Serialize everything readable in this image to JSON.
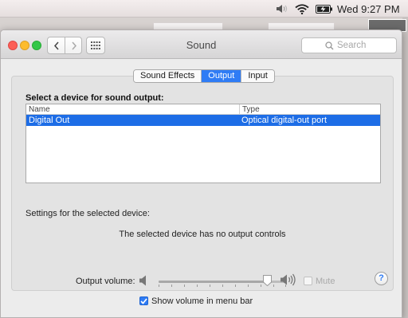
{
  "menubar": {
    "clock": "Wed 9:27 PM",
    "icons": [
      "volume-icon",
      "wifi-icon",
      "battery-charging-icon"
    ]
  },
  "window": {
    "title": "Sound",
    "search_placeholder": "Search"
  },
  "tabs": [
    {
      "label": "Sound Effects",
      "active": false
    },
    {
      "label": "Output",
      "active": true
    },
    {
      "label": "Input",
      "active": false
    }
  ],
  "output": {
    "select_label": "Select a device for sound output:",
    "columns": [
      "Name",
      "Type"
    ],
    "rows": [
      {
        "name": "Digital Out",
        "type": "Optical digital-out port",
        "selected": true
      }
    ],
    "settings_label": "Settings for the selected device:",
    "no_controls_text": "The selected device has no output controls",
    "help_label": "?"
  },
  "volume": {
    "label": "Output volume:",
    "level": 0.85,
    "mute_label": "Mute",
    "mute_checked": false,
    "mute_enabled": false,
    "show_in_menubar_label": "Show volume in menu bar",
    "show_in_menubar_checked": true
  },
  "colors": {
    "accent": "#2f7cf5",
    "selection": "#1d6de6"
  }
}
